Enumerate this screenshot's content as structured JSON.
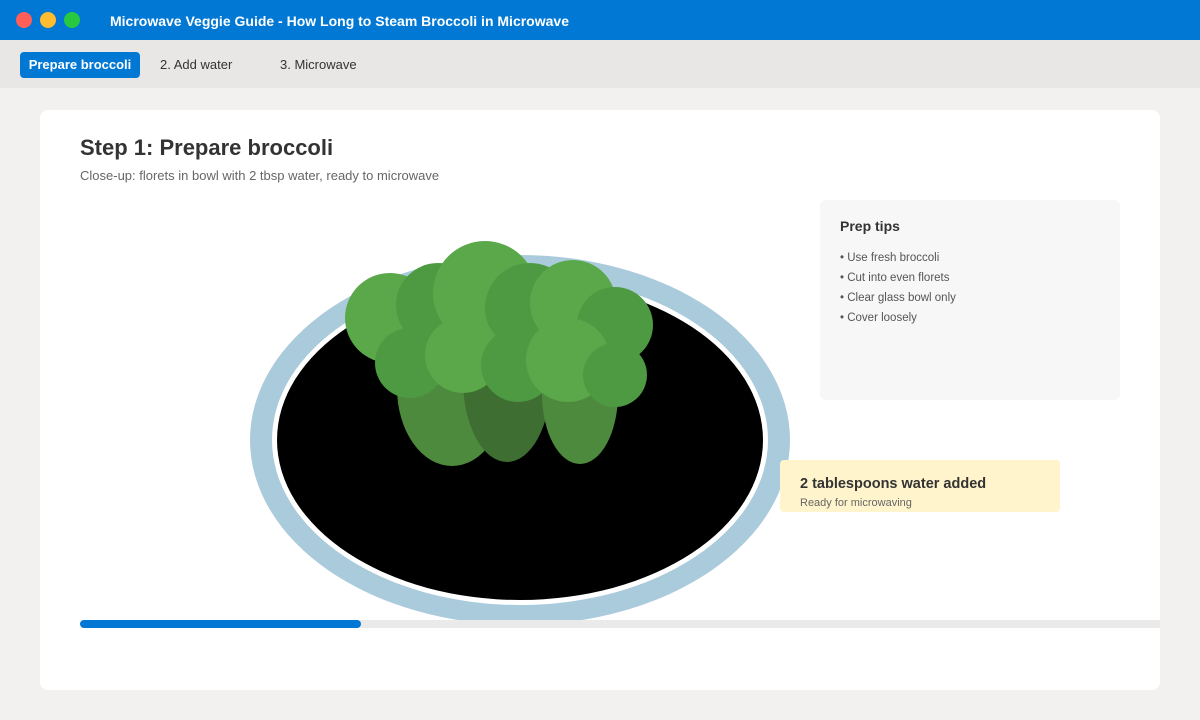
{
  "window": {
    "title": "Microwave Veggie Guide - How Long to Steam Broccoli in Microwave"
  },
  "tabs": [
    {
      "label": "Prepare broccoli",
      "active": true
    },
    {
      "label": "2. Add water",
      "active": false
    },
    {
      "label": "3. Microwave",
      "active": false
    }
  ],
  "step": {
    "title": "Step 1: Prepare broccoli",
    "subtitle": "Close-up: florets in bowl with 2 tbsp water, ready to microwave"
  },
  "tips": {
    "title": "Prep tips",
    "items": [
      "• Use fresh broccoli",
      "• Cut into even florets",
      "• Clear glass bowl only",
      "• Cover loosely"
    ]
  },
  "note": {
    "title": "2 tablespoons water added",
    "subtitle": "Ready for microwaving"
  },
  "progress": {
    "fraction": 0.26
  },
  "colors": {
    "accent": "#0078d4",
    "note_bg": "#fff4cc",
    "bowl_rim": "#aacbdb",
    "broccoli_dark": "#4e8a3d",
    "broccoli_light": "#5aa84a"
  }
}
